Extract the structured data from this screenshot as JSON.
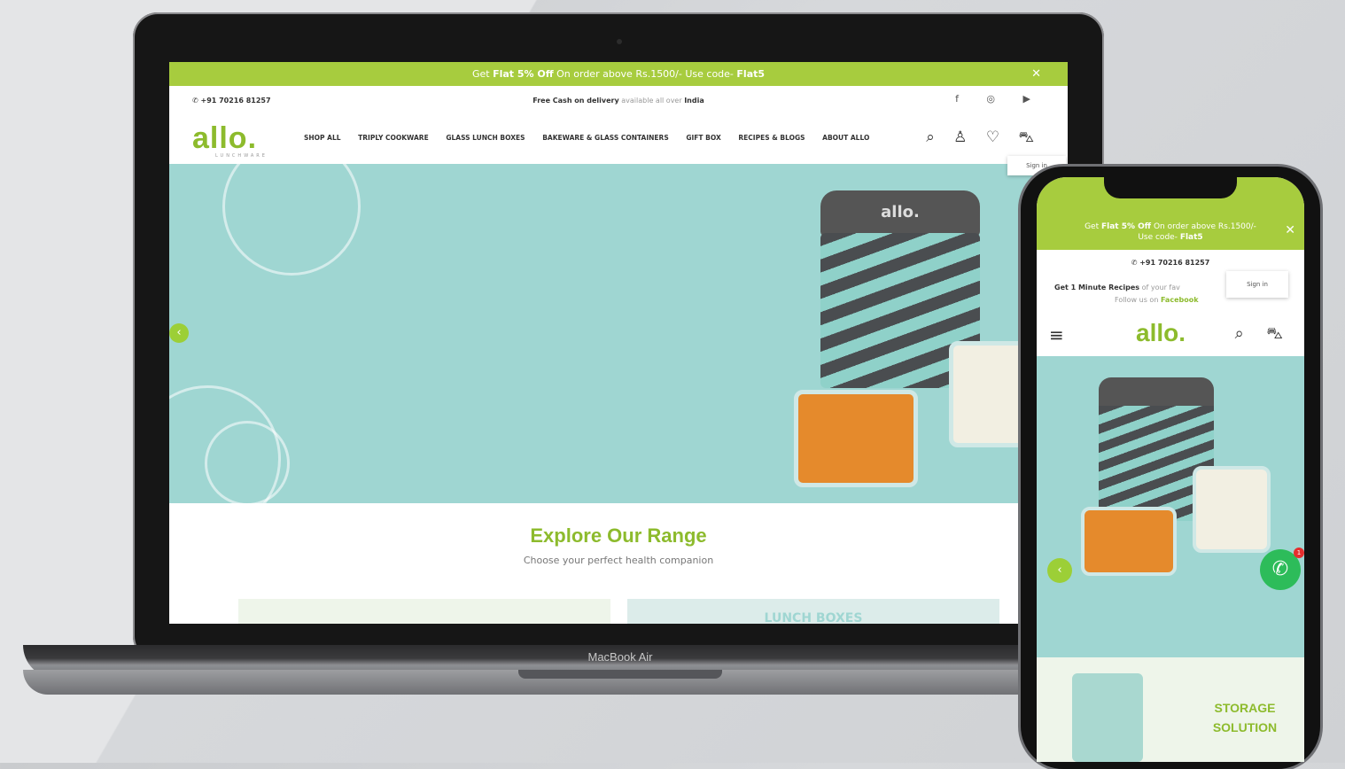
{
  "laptop": {
    "promo": {
      "prefix": "Get ",
      "bold1": "Flat 5% Off",
      "middle": " On order above Rs.1500/- Use code- ",
      "bold2": "Flat5",
      "close": "✕"
    },
    "topbar": {
      "phone": "✆ +91 70216 81257",
      "delivery_bold": "Free Cash on delivery",
      "delivery_light": " available all over ",
      "delivery_region": "India",
      "social_icons": "f ◎ ▶"
    },
    "logo": "allo.",
    "logo_sub": "LUNCHWARE",
    "nav": [
      "SHOP ALL",
      "TRIPLY COOKWARE",
      "GLASS LUNCH BOXES",
      "BAKEWARE & GLASS CONTAINERS",
      "GIFT BOX",
      "RECIPES & BLOGS",
      "ABOUT ALLO"
    ],
    "nav_icons": "⌕ ♙ ♡ ⛍",
    "signin_tooltip": "Sign in",
    "slider_prev": "‹",
    "bag_brand": "allo.",
    "explore_title": "Explore Our Range",
    "explore_sub": "Choose your perfect health companion",
    "card2_label": "LUNCH BOXES",
    "device_label": "MacBook Air"
  },
  "phone": {
    "promo_line1_prefix": "Get ",
    "promo_line1_bold": "Flat 5% Off",
    "promo_line1_rest": " On order above Rs.1500/-",
    "promo_line2_prefix": "Use code- ",
    "promo_line2_bold": "Flat5",
    "promo_close": "✕",
    "phone": "✆ +91 70216 81257",
    "recipes_bold": "Get 1 Minute Recipes",
    "recipes_light": " of your fav",
    "follow_prefix": "Follow us on ",
    "follow_link": "Facebook",
    "signin_tooltip": "Sign in",
    "menu_icon": "≡",
    "logo": "allo.",
    "icons": "⌕ ⛍",
    "slider_prev": "‹",
    "whatsapp_icon": "✆",
    "whatsapp_badge": "1",
    "storage_line1": "STORAGE",
    "storage_line2": "SOLUTION"
  },
  "colors": {
    "accent": "#a7cc3e",
    "hero_bg": "#9fd6d2",
    "logo_green": "#8dbb2d",
    "whatsapp": "#2dbc5a"
  }
}
